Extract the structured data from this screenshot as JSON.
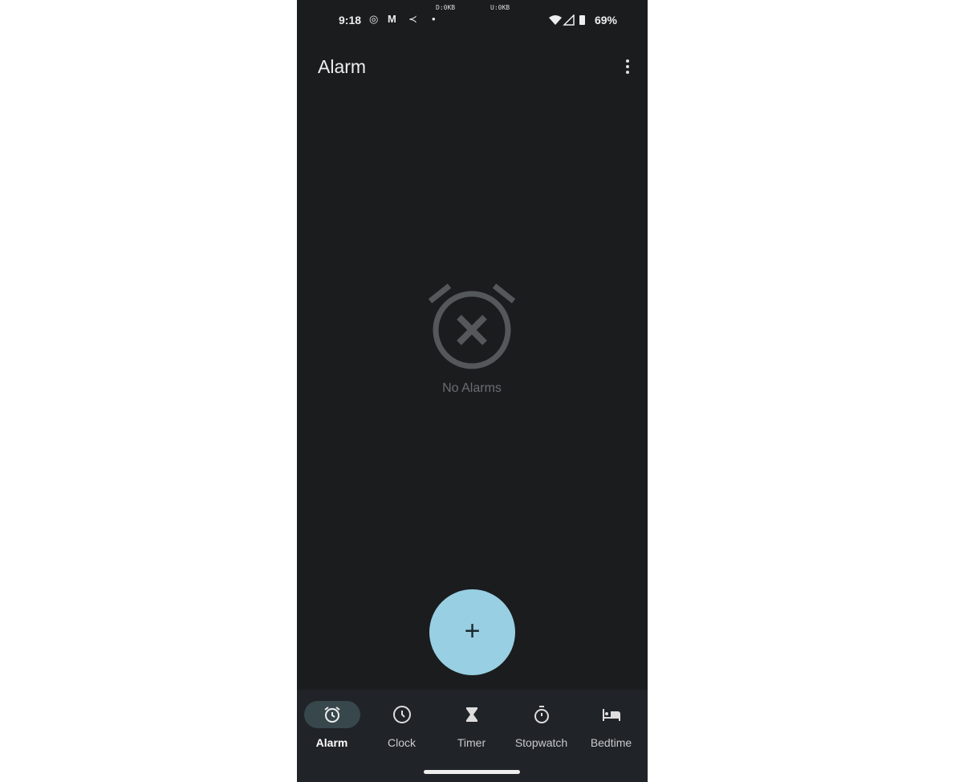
{
  "status_bar": {
    "time": "9:18",
    "download": "D:0KB",
    "upload": "U:0KB",
    "battery": "69%"
  },
  "header": {
    "title": "Alarm"
  },
  "empty_state": {
    "text": "No Alarms"
  },
  "fab": {
    "label": "+"
  },
  "nav": {
    "items": [
      {
        "label": "Alarm",
        "active": true
      },
      {
        "label": "Clock"
      },
      {
        "label": "Timer"
      },
      {
        "label": "Stopwatch"
      },
      {
        "label": "Bedtime"
      }
    ]
  },
  "colors": {
    "background": "#1b1c1e",
    "fab": "#98cfe2",
    "nav": "#202327",
    "active_pill": "#37474c"
  }
}
